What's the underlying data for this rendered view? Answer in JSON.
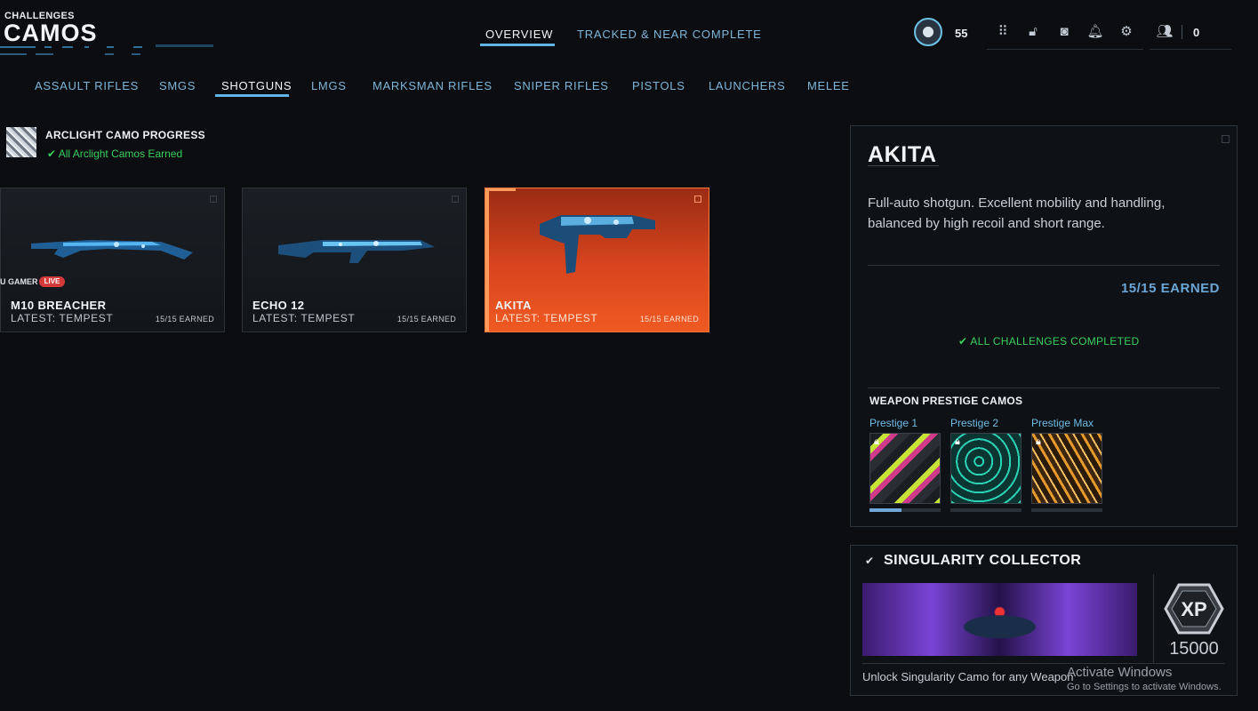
{
  "header": {
    "subtitle": "CHALLENGES",
    "title": "CAMOS",
    "tabs": [
      {
        "label": "OVERVIEW",
        "active": true
      },
      {
        "label": "TRACKED & NEAR COMPLETE",
        "active": false
      }
    ],
    "player_level": "55",
    "friends_count": "0",
    "icons": [
      "grid-icon",
      "unlock-icon",
      "camera-icon",
      "bell-icon",
      "gear-icon",
      "friends-icon"
    ],
    "accent_color": "#5fb6e6"
  },
  "categories": [
    "ASSAULT RIFLES",
    "SMGS",
    "SHOTGUNS",
    "LMGS",
    "MARKSMAN RIFLES",
    "SNIPER RIFLES",
    "PISTOLS",
    "LAUNCHERS",
    "MELEE"
  ],
  "active_category": "SHOTGUNS",
  "arclight": {
    "title": "ARCLIGHT CAMO PROGRESS",
    "status": "All Arclight Camos Earned"
  },
  "weapons": [
    {
      "name": "M10 BREACHER",
      "latest": "LATEST: TEMPEST",
      "earned": "15/15 EARNED",
      "selected": false
    },
    {
      "name": "ECHO 12",
      "latest": "LATEST: TEMPEST",
      "earned": "15/15 EARNED",
      "selected": false
    },
    {
      "name": "AKITA",
      "latest": "LATEST: TEMPEST",
      "earned": "15/15 EARNED",
      "selected": true
    }
  ],
  "streamer_overlay": {
    "name": "U GAMER",
    "badge": "LIVE"
  },
  "detail": {
    "title": "AKITA",
    "description": "Full-auto shotgun. Excellent mobility and handling, balanced by high recoil and short range.",
    "earned": "15/15 EARNED",
    "complete": "ALL CHALLENGES COMPLETED",
    "prestige_title": "WEAPON PRESTIGE CAMOS",
    "prestige": [
      {
        "label": "Prestige 1",
        "locked": true
      },
      {
        "label": "Prestige 2",
        "locked": true
      },
      {
        "label": "Prestige Max",
        "locked": true
      }
    ]
  },
  "singularity": {
    "title": "SINGULARITY COLLECTOR",
    "xp_label": "XP",
    "xp_amount": "15000",
    "description": "Unlock Singularity Camo for any Weapon"
  },
  "windows_watermark": {
    "title": "Activate Windows",
    "subtitle": "Go to Settings to activate Windows."
  }
}
